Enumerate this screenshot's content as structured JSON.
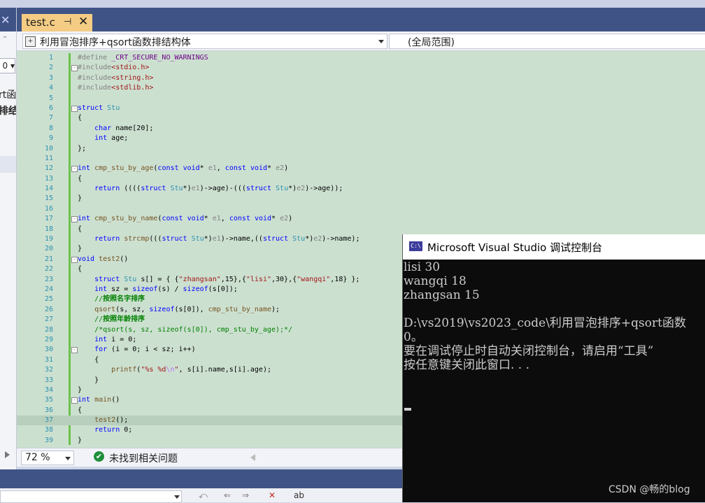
{
  "document_tab": {
    "title": "test.c",
    "pin_glyph": "⌐",
    "close_glyph": "✕"
  },
  "navbar": {
    "scope": "利用冒泡排序+qsort函数排结构体",
    "global_scope": "(全局范围)"
  },
  "left_panel": {
    "close_glyph": "✕",
    "pin_glyph": "ᵔ",
    "dropdown_fragment": "0 ▾",
    "text1": "rt函",
    "text2": "排结"
  },
  "editor": {
    "lines": [
      {
        "n": "1",
        "html": "<span class=\"pp\">#define </span><span class=\"mac\">_CRT_SECURE_NO_WARNINGS</span>"
      },
      {
        "n": "2",
        "fold": "-",
        "html": "<span class=\"pp\">#include</span><span class=\"inc\">&lt;stdio.h&gt;</span>"
      },
      {
        "n": "3",
        "html": "<span class=\"pp\">#include</span><span class=\"inc\">&lt;string.h&gt;</span>"
      },
      {
        "n": "4",
        "html": "<span class=\"pp\">#include</span><span class=\"inc\">&lt;stdlib.h&gt;</span>"
      },
      {
        "n": "5",
        "html": ""
      },
      {
        "n": "6",
        "fold": "-",
        "html": "<span class=\"k\">struct</span> <span class=\"ty\">Stu</span>"
      },
      {
        "n": "7",
        "html": "{"
      },
      {
        "n": "8",
        "html": "    <span class=\"k\">char</span> name[20];"
      },
      {
        "n": "9",
        "html": "    <span class=\"k\">int</span> age;"
      },
      {
        "n": "10",
        "html": "};"
      },
      {
        "n": "11",
        "html": ""
      },
      {
        "n": "12",
        "fold": "-",
        "html": "<span class=\"k\">int</span> <span class=\"fn\">cmp_stu_by_age</span>(<span class=\"k\">const</span> <span class=\"k\">void</span>* <span class=\"par\">e1</span>, <span class=\"k\">const</span> <span class=\"k\">void</span>* <span class=\"par\">e2</span>)"
      },
      {
        "n": "13",
        "html": "{"
      },
      {
        "n": "14",
        "html": "    <span class=\"k\">return</span> ((((<span class=\"k\">struct</span> <span class=\"ty\">Stu</span>*)<span class=\"par\">e1</span>)-&gt;age)-(((<span class=\"k\">struct</span> <span class=\"ty\">Stu</span>*)<span class=\"par\">e2</span>)-&gt;age));"
      },
      {
        "n": "15",
        "html": "}"
      },
      {
        "n": "16",
        "html": ""
      },
      {
        "n": "17",
        "fold": "-",
        "html": "<span class=\"k\">int</span> <span class=\"fn\">cmp_stu_by_name</span>(<span class=\"k\">const</span> <span class=\"k\">void</span>* <span class=\"par\">e1</span>, <span class=\"k\">const</span> <span class=\"k\">void</span>* <span class=\"par\">e2</span>)"
      },
      {
        "n": "18",
        "html": "{"
      },
      {
        "n": "19",
        "html": "    <span class=\"k\">return</span> <span class=\"fn\">strcmp</span>(((<span class=\"k\">struct</span> <span class=\"ty\">Stu</span>*)<span class=\"par\">e1</span>)-&gt;name,((<span class=\"k\">struct</span> <span class=\"ty\">Stu</span>*)<span class=\"par\">e2</span>)-&gt;name);"
      },
      {
        "n": "20",
        "html": "}"
      },
      {
        "n": "21",
        "fold": "-",
        "html": "<span class=\"k\">void</span> <span class=\"fn\">test2</span>()"
      },
      {
        "n": "22",
        "html": "{"
      },
      {
        "n": "23",
        "html": "    <span class=\"k\">struct</span> <span class=\"ty\">Stu</span> s[] = { {<span class=\"str\">\"zhangsan\"</span>,15},{<span class=\"str\">\"lisi\"</span>,30},{<span class=\"str\">\"wangqi\"</span>,18} };"
      },
      {
        "n": "24",
        "html": "    <span class=\"k\">int</span> sz = <span class=\"k\">sizeof</span>(s) / <span class=\"k\">sizeof</span>(s[0]);"
      },
      {
        "n": "25",
        "html": "    <span class=\"cm\">//</span><span class=\"cmb\">按照名字排序</span>"
      },
      {
        "n": "26",
        "html": "    <span class=\"fn\">qsort</span>(s, sz, <span class=\"k\">sizeof</span>(s[0]), <span class=\"fn\">cmp_stu_by_name</span>);"
      },
      {
        "n": "27",
        "html": "    <span class=\"cm\">//</span><span class=\"cmb\">按照年龄排序</span>"
      },
      {
        "n": "28",
        "html": "    <span class=\"cm\">/*qsort(s, sz, sizeof(s[0]), cmp_stu_by_age);*/</span>"
      },
      {
        "n": "29",
        "html": "    <span class=\"k\">int</span> i = 0;"
      },
      {
        "n": "30",
        "fold": "-",
        "html": "    <span class=\"k\">for</span> (i = 0; i &lt; sz; i++)"
      },
      {
        "n": "31",
        "html": "    {"
      },
      {
        "n": "32",
        "html": "        <span class=\"fn\">printf</span>(<span class=\"str\">\"%s %d</span><span class=\"esc\">\\n</span><span class=\"str\">\"</span>, s[i].name,s[i].age);"
      },
      {
        "n": "33",
        "html": "    }"
      },
      {
        "n": "34",
        "html": "}"
      },
      {
        "n": "35",
        "fold": "-",
        "html": "<span class=\"k\">int</span> <span class=\"fn\">main</span>()"
      },
      {
        "n": "36",
        "html": "{"
      },
      {
        "n": "37",
        "cur": true,
        "html": "    <span class=\"fn\">test2</span>();"
      },
      {
        "n": "38",
        "html": "    <span class=\"k\">return</span> 0;"
      },
      {
        "n": "39",
        "html": "}"
      }
    ]
  },
  "status": {
    "zoom": "72 %",
    "issues": "未找到相关问题",
    "ok_glyph": "✔"
  },
  "console": {
    "title": "Microsoft Visual Studio 调试控制台",
    "icon_text": "C:\\",
    "lines": [
      "lisi 30",
      "wangqi 18",
      "zhangsan 15",
      "",
      "D:\\vs2019\\vs2023_code\\利用冒泡排序+qsort函数",
      "0。",
      "要在调试停止时自动关闭控制台，请启用“工具”",
      "按任意键关闭此窗口. . ."
    ]
  },
  "watermark": "CSDN @畅的blog",
  "bottom_toolbar": {
    "icons": [
      "⤺",
      "⇐",
      "⇒",
      "✕",
      "ab"
    ]
  }
}
